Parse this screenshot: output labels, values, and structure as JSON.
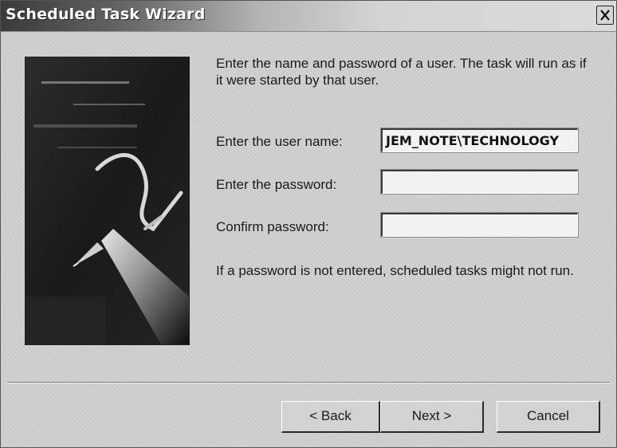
{
  "window": {
    "title": "Scheduled Task Wizard",
    "close_label": "X"
  },
  "content": {
    "intro": "Enter the name and password of a user. The task will run as if it were started by that user.",
    "user_label": "Enter the user name:",
    "user_value": "JEM_NOTE\\TECHNOLOGY",
    "password_label": "Enter the password:",
    "password_value": "",
    "confirm_label": "Confirm password:",
    "confirm_value": "",
    "note": "If a password is not entered, scheduled tasks might not run."
  },
  "buttons": {
    "back": "< Back",
    "next": "Next >",
    "cancel": "Cancel"
  }
}
